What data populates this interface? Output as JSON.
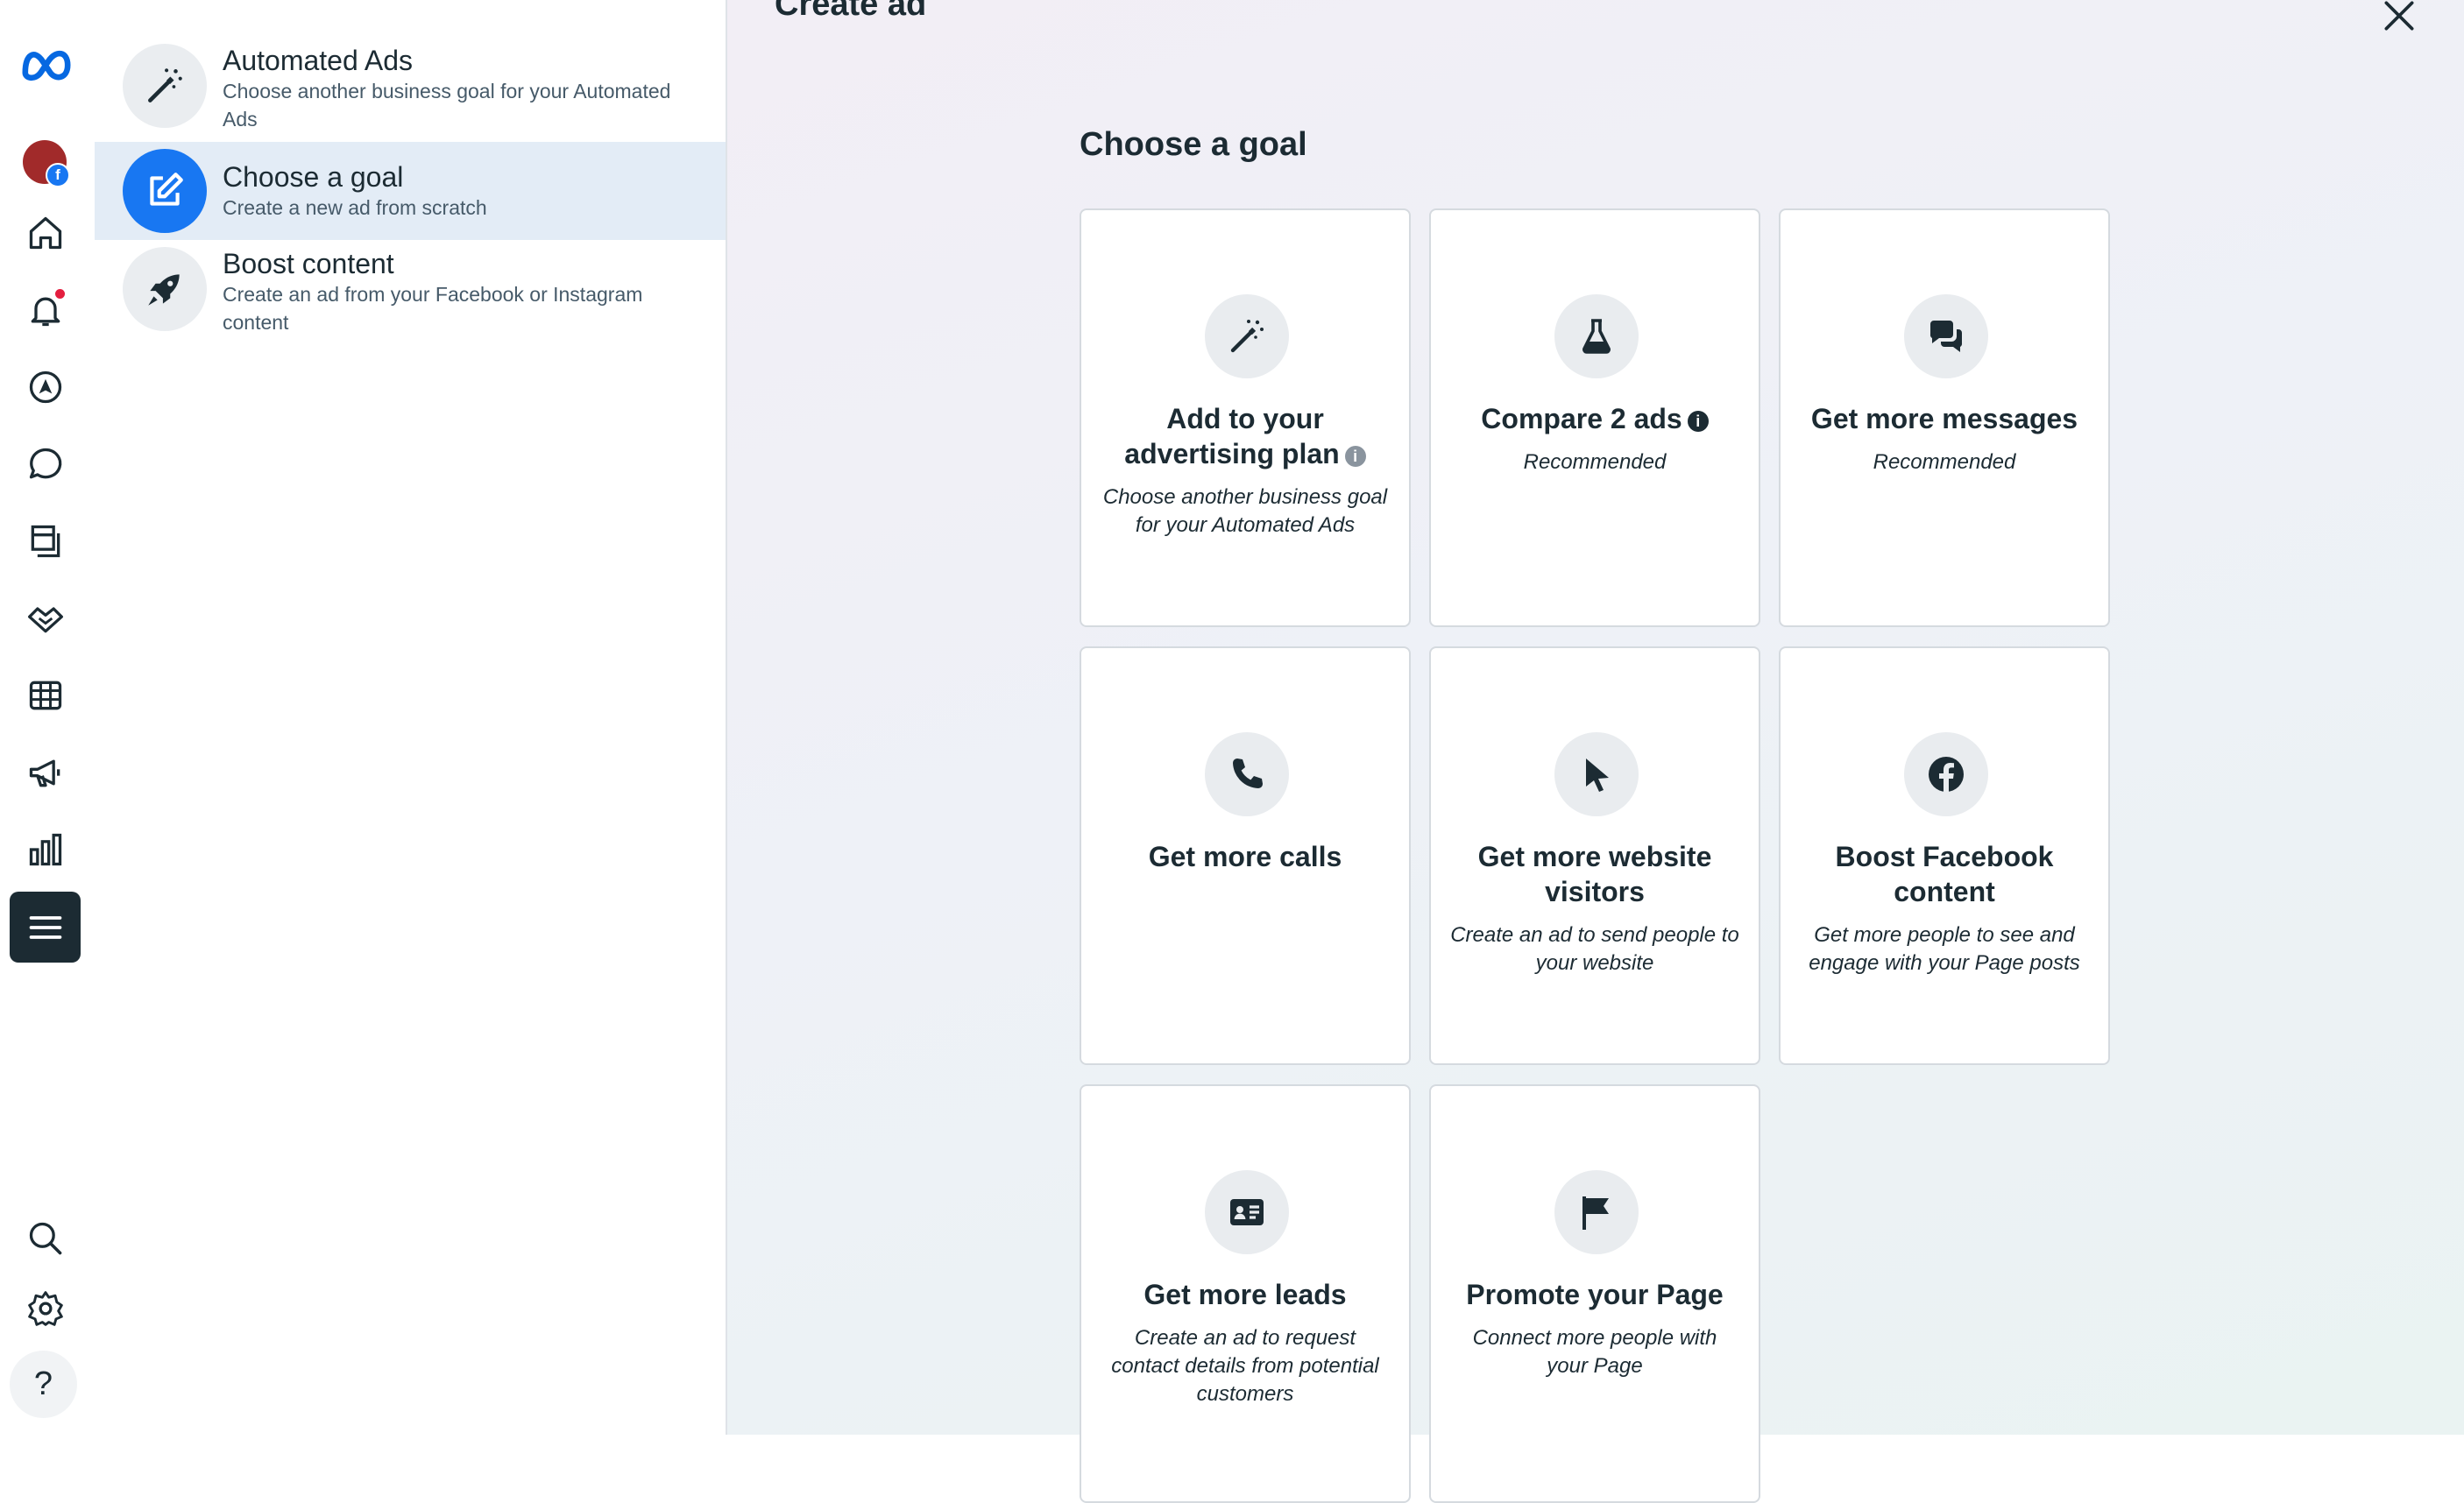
{
  "rail": {
    "icons": [
      "meta-logo-icon",
      "account-avatar",
      "home-icon",
      "notifications-icon",
      "ads-manager-icon",
      "messages-icon",
      "pages-icon",
      "partnerships-icon",
      "table-icon",
      "campaigns-icon",
      "insights-icon",
      "menu-icon",
      "search-icon",
      "settings-icon",
      "help-icon"
    ],
    "help_glyph": "?"
  },
  "side_panel": {
    "items": [
      {
        "title": "Automated Ads",
        "subtitle": "Choose another business goal for your Automated Ads",
        "icon": "magic-wand-icon"
      },
      {
        "title": "Choose a goal",
        "subtitle": "Create a new ad from scratch",
        "icon": "edit-icon",
        "selected": true
      },
      {
        "title": "Boost content",
        "subtitle": "Create an ad from your Facebook or Instagram content",
        "icon": "rocket-icon"
      }
    ]
  },
  "main": {
    "title": "Create ad",
    "section_title": "Choose a goal",
    "cards": [
      {
        "title": "Add to your advertising plan",
        "subtitle": "Choose another business goal for your Automated Ads",
        "icon": "magic-wand-icon"
      },
      {
        "title": "Compare 2 ads",
        "subtitle": "Recommended",
        "icon": "flask-icon"
      },
      {
        "title": "Get more messages",
        "subtitle": "Recommended",
        "icon": "chat-bubbles-icon"
      },
      {
        "title": "Get more calls",
        "subtitle": "",
        "icon": "phone-icon"
      },
      {
        "title": "Get more website visitors",
        "subtitle": "Create an ad to send people to your website",
        "icon": "cursor-icon"
      },
      {
        "title": "Boost Facebook content",
        "subtitle": "Get more people to see and engage with your Page posts",
        "icon": "facebook-icon"
      },
      {
        "title": "Get more leads",
        "subtitle": "Create an ad to request contact details from potential customers",
        "icon": "contact-card-icon"
      },
      {
        "title": "Promote your Page",
        "subtitle": "Connect more people with your Page",
        "icon": "flag-icon"
      }
    ]
  },
  "colors": {
    "accent": "#1877f2",
    "text": "#1c2b33",
    "selected_bg": "#e3ecf6"
  }
}
